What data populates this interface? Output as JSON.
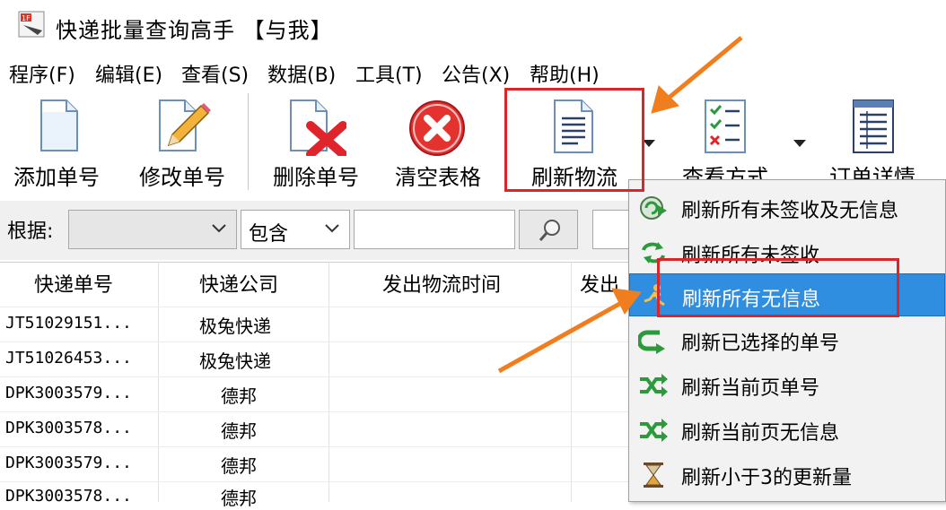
{
  "window": {
    "title": "快递批量查询高手 【与我】",
    "app_icon": "app-logo-icon"
  },
  "menu": {
    "items": [
      {
        "label": "程序(F)"
      },
      {
        "label": "编辑(E)"
      },
      {
        "label": "查看(S)"
      },
      {
        "label": "数据(B)"
      },
      {
        "label": "工具(T)"
      },
      {
        "label": "公告(X)"
      },
      {
        "label": "帮助(H)"
      }
    ]
  },
  "toolbar": {
    "add_label": "添加单号",
    "edit_label": "修改单号",
    "delete_label": "删除单号",
    "clear_label": "清空表格",
    "refresh_label": "刷新物流",
    "view_label": "查看方式",
    "order_label": "订单详情"
  },
  "search": {
    "label": "根据:",
    "field_value": "",
    "match_value": "包含",
    "keyword": ""
  },
  "table": {
    "columns": [
      "快递单号",
      "快递公司",
      "发出物流时间",
      "发出"
    ],
    "rows": [
      {
        "tracking": "JT51029151...",
        "company": "极兔快递"
      },
      {
        "tracking": "JT51026453...",
        "company": "极兔快递"
      },
      {
        "tracking": "DPK3003579...",
        "company": "德邦"
      },
      {
        "tracking": "DPK3003578...",
        "company": "德邦"
      },
      {
        "tracking": "DPK3003579...",
        "company": "德邦"
      },
      {
        "tracking": "DPK3003578...",
        "company": "德邦"
      }
    ]
  },
  "refresh_menu": {
    "items": [
      {
        "label": "刷新所有未签收及无信息",
        "icon": "refresh-all-icon"
      },
      {
        "label": "刷新所有未签收",
        "icon": "refresh-arrows-icon"
      },
      {
        "label": "刷新所有无信息",
        "icon": "refresh-runner-icon",
        "selected": true
      },
      {
        "label": "刷新已选择的单号",
        "icon": "refresh-selected-icon"
      },
      {
        "label": "刷新当前页单号",
        "icon": "shuffle-icon"
      },
      {
        "label": "刷新当前页无信息",
        "icon": "shuffle-icon"
      },
      {
        "label": "刷新小于3的更新量",
        "icon": "hourglass-icon"
      }
    ]
  },
  "colors": {
    "highlight": "#2f8ee0",
    "annotation_red": "#d9262b",
    "annotation_arrow": "#f07e1e"
  }
}
